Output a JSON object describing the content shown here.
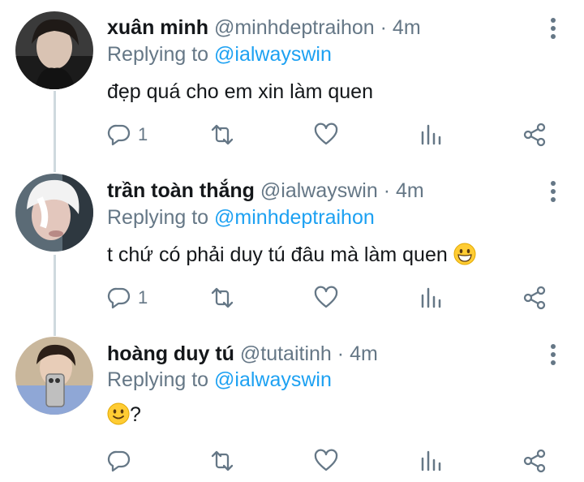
{
  "icons": {
    "reply": "reply-icon",
    "retweet": "retweet-icon",
    "like": "heart-icon",
    "analytics": "analytics-icon",
    "share": "share-icon",
    "more": "more-vertical-icon"
  },
  "colors": {
    "link": "#1da1f2",
    "secondary_text": "#657786",
    "primary_text": "#14171a",
    "thread_line": "#cfd9de"
  },
  "tweets": [
    {
      "display_name": "xuân minh",
      "handle": "@minhdeptraihon",
      "separator": "·",
      "time": "4m",
      "replying_prefix": "Replying to",
      "replying_to": "@ialwayswin",
      "text": "đẹp quá cho em xin làm quen",
      "reply_count": "1"
    },
    {
      "display_name": "trần toàn thắng",
      "handle": "@ialwayswin",
      "separator": "·",
      "time": "4m",
      "replying_prefix": "Replying to",
      "replying_to": "@minhdeptraihon",
      "text": "t chứ có phải duy tú đâu mà làm quen",
      "text_emoji": "grinning-face-emoji",
      "reply_count": "1"
    },
    {
      "display_name": "hoàng duy tú",
      "handle": "@tutaitinh",
      "separator": "·",
      "time": "4m",
      "replying_prefix": "Replying to",
      "replying_to": "@ialwayswin",
      "text_emoji": "slightly-smiling-face-emoji",
      "text": "?",
      "reply_count": ""
    }
  ]
}
